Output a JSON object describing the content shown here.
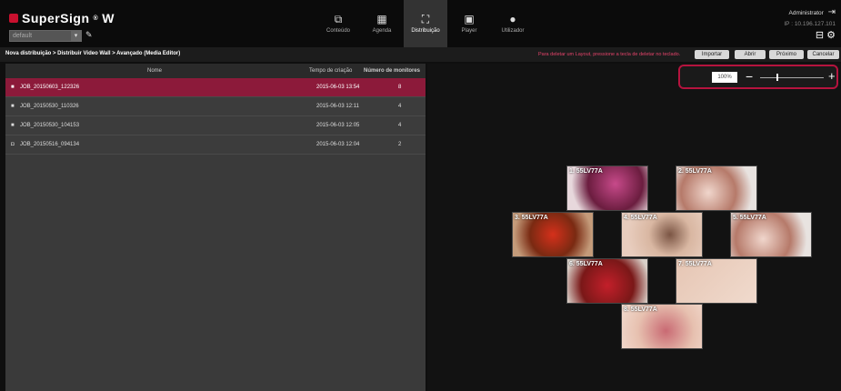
{
  "app": {
    "title": "SuperSign",
    "title_suffix": "W",
    "group": "default"
  },
  "nav": [
    {
      "label": "Conteúdo",
      "icon": "content-icon"
    },
    {
      "label": "Agenda",
      "icon": "calendar-icon"
    },
    {
      "label": "Distribuição",
      "icon": "distribution-icon"
    },
    {
      "label": "Player",
      "icon": "player-icon"
    },
    {
      "label": "Utilizador",
      "icon": "user-icon"
    }
  ],
  "user": {
    "name": "Administrator",
    "ip": "IP : 10.196.127.101"
  },
  "breadcrumb": "Nova distribuição > Distribuir Video Wall > Avançado (Media Editor)",
  "hint": "Para deletar um Layout, pressione a tecla de deletar no teclado.",
  "buttons": {
    "import": "Importar",
    "open": "Abrir",
    "next": "Próximo",
    "cancel": "Cancelar"
  },
  "table": {
    "headers": {
      "name": "Nome",
      "time": "Tempo de criação",
      "count": "Número de monitores"
    },
    "rows": [
      {
        "name": "JOB_20150603_122326",
        "time": "2015-06-03 13:54",
        "count": "8",
        "icon": "video-icon"
      },
      {
        "name": "JOB_20150530_110326",
        "time": "2015-06-03 12:11",
        "count": "4",
        "icon": "video-icon"
      },
      {
        "name": "JOB_20150530_104153",
        "time": "2015-06-03 12:05",
        "count": "4",
        "icon": "video-icon"
      },
      {
        "name": "JOB_20150516_094134",
        "time": "2015-06-03 12:04",
        "count": "2",
        "icon": "image-icon"
      }
    ]
  },
  "zoom": {
    "value": "100%",
    "level": 0.25
  },
  "tiles": [
    {
      "label": "1. 55LV77A"
    },
    {
      "label": "2. 55LV77A"
    },
    {
      "label": "3. 55LV77A"
    },
    {
      "label": "4. 55LV77A"
    },
    {
      "label": "5. 55LV77A"
    },
    {
      "label": "6. 55LV77A"
    },
    {
      "label": "7. 55LV77A"
    },
    {
      "label": "8. 55LV77A"
    }
  ]
}
